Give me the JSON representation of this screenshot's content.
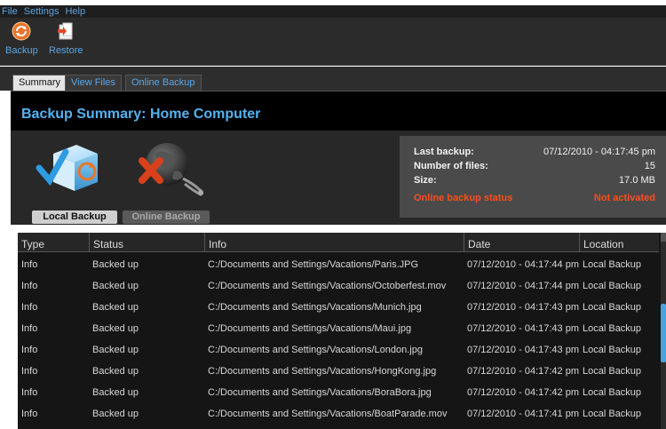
{
  "menu": [
    "File",
    "Settings",
    "Help"
  ],
  "toolbar": {
    "backup_label": "Backup",
    "restore_label": "Restore"
  },
  "tabs": [
    {
      "label": "Summary",
      "active": true
    },
    {
      "label": "View Files",
      "active": false
    },
    {
      "label": "Online Backup",
      "active": false
    }
  ],
  "title": "Backup Summary: Home Computer",
  "modes": {
    "local_label": "Local Backup",
    "online_label": "Online Backup"
  },
  "status": {
    "last_backup_label": "Last backup:",
    "last_backup_value": "07/12/2010 - 04:17:45 pm",
    "num_files_label": "Number of files:",
    "num_files_value": "15",
    "size_label": "Size:",
    "size_value": "17.0 MB",
    "online_status_link": "Online backup status",
    "not_activated_link": "Not activated"
  },
  "table": {
    "columns": [
      "Type",
      "Status",
      "Info",
      "Date",
      "Location"
    ],
    "rows": [
      [
        "Info",
        "Backed up",
        "C:/Documents and Settings/Vacations/Paris.JPG",
        "07/12/2010 - 04:17:44 pm",
        "Local Backup"
      ],
      [
        "Info",
        "Backed up",
        "C:/Documents and Settings/Vacations/Octoberfest.mov",
        "07/12/2010 - 04:17:44 pm",
        "Local Backup"
      ],
      [
        "Info",
        "Backed up",
        "C:/Documents and Settings/Vacations/Munich.jpg",
        "07/12/2010 - 04:17:43 pm",
        "Local Backup"
      ],
      [
        "Info",
        "Backed up",
        "C:/Documents and Settings/Vacations/Maui.jpg",
        "07/12/2010 - 04:17:43 pm",
        "Local Backup"
      ],
      [
        "Info",
        "Backed up",
        "C:/Documents and Settings/Vacations/London.jpg",
        "07/12/2010 - 04:17:43 pm",
        "Local Backup"
      ],
      [
        "Info",
        "Backed up",
        "C:/Documents and Settings/Vacations/HongKong.jpg",
        "07/12/2010 - 04:17:42 pm",
        "Local Backup"
      ],
      [
        "Info",
        "Backed up",
        "C:/Documents and Settings/Vacations/BoraBora.jpg",
        "07/12/2010 - 04:17:42 pm",
        "Local Backup"
      ],
      [
        "Info",
        "Backed up",
        "C:/Documents and Settings/Vacations/BoatParade.mov",
        "07/12/2010 - 04:17:41 pm",
        "Local Backup"
      ]
    ]
  },
  "icons": {
    "backup": "backup-icon",
    "restore": "restore-icon",
    "local_backup": "local-backup-cube-icon",
    "online_backup": "online-backup-globe-icon"
  },
  "colors": {
    "accent_blue": "#55b2f0",
    "link_orange": "#ff4d1a"
  }
}
